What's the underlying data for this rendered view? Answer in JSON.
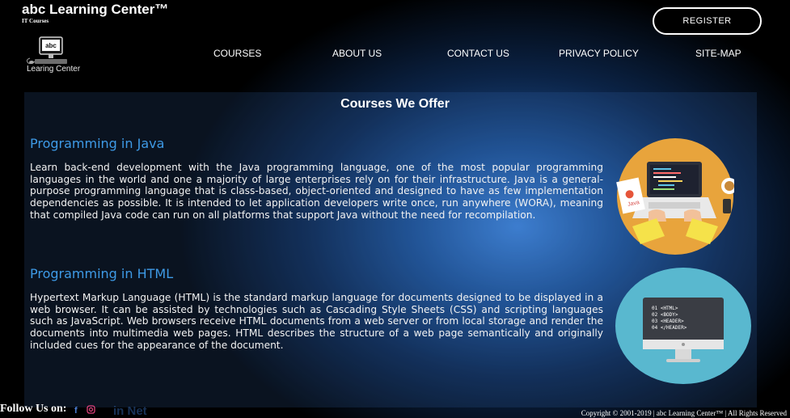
{
  "header": {
    "brand_title": "abc Learning Center™",
    "brand_subtitle": "IT Courses",
    "logo_screen_text": "abc",
    "logo_caption": "Learing Center",
    "register_label": "REGISTER"
  },
  "nav": {
    "items": [
      {
        "label": "COURSES"
      },
      {
        "label": "ABOUT US"
      },
      {
        "label": "CONTACT US"
      },
      {
        "label": "PRIVACY POLICY"
      },
      {
        "label": "SITE-MAP"
      }
    ]
  },
  "main": {
    "title": "Courses We Offer",
    "courses": [
      {
        "heading": "Programming in Java",
        "text": "Learn back-end development with the Java programming language, one of the most popular programming languages in the world and one a majority of large enterprises rely on for their infrastructure. Java is a general-purpose programming language that is class-based, object-oriented and designed to have as few implementation dependencies as possible. It is intended to let application developers write once, run anywhere (WORA), meaning that compiled Java code can run on all platforms that support Java without the need for recompilation.",
        "image_icon": "laptop-java-illustration",
        "image_label": "Java"
      },
      {
        "heading": "Programming in HTML",
        "text": "Hypertext Markup Language (HTML) is the standard markup language for documents designed to be displayed in a web browser. It can be assisted by technologies such as Cascading Style Sheets (CSS) and scripting languages such as JavaScript. Web browsers receive HTML documents from a web server or from local storage and render the documents into multimedia web pages. HTML describes the structure of a web page semantically and originally included cues for the appearance of the document.",
        "image_icon": "monitor-html-code-illustration",
        "code_lines": [
          "01 <HTML>",
          "02 <BODY>",
          "03 <HEADER>",
          "04 </HEADER>"
        ]
      }
    ]
  },
  "footer": {
    "follow_label": "Follow Us on:",
    "social_icons": [
      "facebook-icon",
      "instagram-icon"
    ],
    "ghost_text": "in    Net",
    "copyright": "Copyright © 2001-2019 | abc Learning Center™ | All Rights Reserved"
  },
  "colors": {
    "accent_heading": "#3e9ae6",
    "background_center": "#3d7fd0",
    "background_edge": "#000000"
  }
}
